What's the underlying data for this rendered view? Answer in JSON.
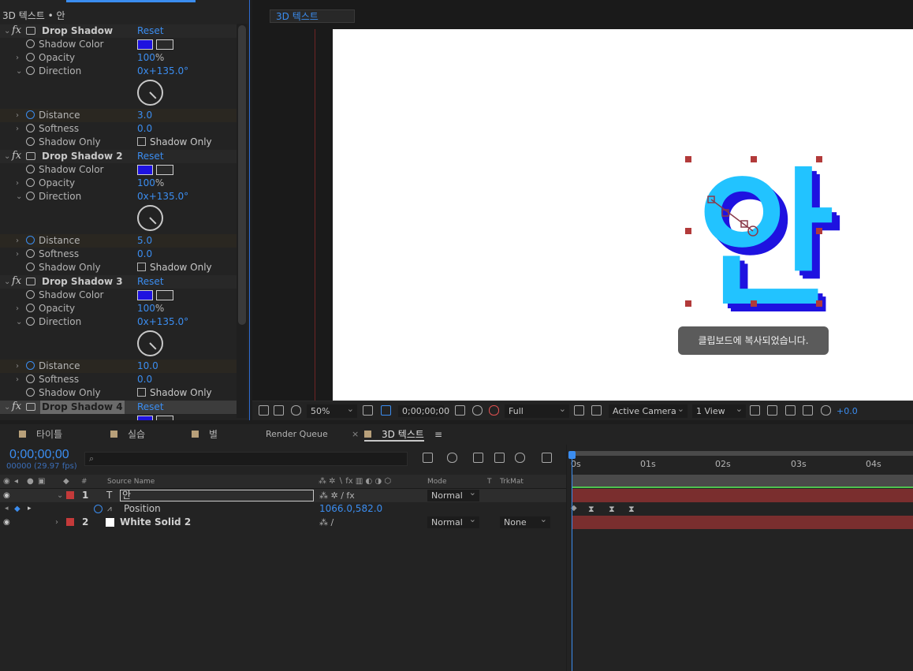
{
  "effect_controls": {
    "header_title": "3D 텍스트 • 안",
    "reset_label": "Reset",
    "effects": [
      {
        "name": "Drop Shadow",
        "shadow_color_label": "Shadow Color",
        "opacity_label": "Opacity",
        "opacity_value": "100",
        "opacity_unit": "%",
        "direction_label": "Direction",
        "direction_value": "0x+135.0°",
        "distance_label": "Distance",
        "distance_value": "3.0",
        "softness_label": "Softness",
        "softness_value": "0.0",
        "shadow_only_label": "Shadow Only",
        "shadow_only_check_label": "Shadow Only"
      },
      {
        "name": "Drop Shadow 2",
        "shadow_color_label": "Shadow Color",
        "opacity_label": "Opacity",
        "opacity_value": "100",
        "opacity_unit": "%",
        "direction_label": "Direction",
        "direction_value": "0x+135.0°",
        "distance_label": "Distance",
        "distance_value": "5.0",
        "softness_label": "Softness",
        "softness_value": "0.0",
        "shadow_only_label": "Shadow Only",
        "shadow_only_check_label": "Shadow Only"
      },
      {
        "name": "Drop Shadow 3",
        "shadow_color_label": "Shadow Color",
        "opacity_label": "Opacity",
        "opacity_value": "100",
        "opacity_unit": "%",
        "direction_label": "Direction",
        "direction_value": "0x+135.0°",
        "distance_label": "Distance",
        "distance_value": "10.0",
        "softness_label": "Softness",
        "softness_value": "0.0",
        "shadow_only_label": "Shadow Only",
        "shadow_only_check_label": "Shadow Only"
      },
      {
        "name": "Drop Shadow 4"
      }
    ],
    "shadow_color": "#1e12e0"
  },
  "viewer": {
    "comp_tab": "3D 텍스트",
    "glyph": "안",
    "toast": "클립보드에 복사되었습니다.",
    "zoom": "50%",
    "timecode": "0;00;00;00",
    "resolution": "Full",
    "camera": "Active Camera",
    "views": "1 View",
    "exposure": "+0.0",
    "glyph_color": "#22c3ff",
    "glyph_shadow_color": "#1e12e0"
  },
  "timeline": {
    "tabs": [
      {
        "label": "타이틀"
      },
      {
        "label": "실습"
      },
      {
        "label": "별"
      },
      {
        "label": "Render Queue"
      },
      {
        "label": "3D 텍스트"
      }
    ],
    "timecode": "0;00;00;00",
    "fps": "00000 (29.97 fps)",
    "search_placeholder": "",
    "col_source_name": "Source Name",
    "col_mode": "Mode",
    "col_t": "T",
    "col_trkmat": "TrkMat",
    "layers": [
      {
        "num": "1",
        "name": "안",
        "mode": "Normal"
      },
      {
        "num": "2",
        "name": "White Solid 2",
        "mode": "Normal",
        "trkmat": "None"
      }
    ],
    "position_label": "Position",
    "position_value": "1066.0,582.0",
    "ruler": [
      "0s",
      "01s",
      "02s",
      "03s",
      "04s"
    ]
  }
}
